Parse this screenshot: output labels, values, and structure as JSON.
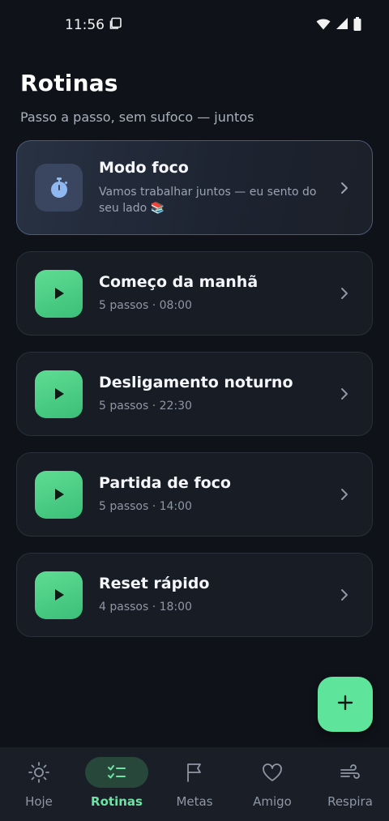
{
  "status_bar": {
    "time": "11:56"
  },
  "header": {
    "title": "Rotinas",
    "subtitle": "Passo a passo, sem sufoco — juntos"
  },
  "focus_card": {
    "title": "Modo foco",
    "subtitle": "Vamos trabalhar juntos — eu sento do seu lado 📚",
    "icon": "stopwatch-icon"
  },
  "routines": [
    {
      "title": "Começo da manhã",
      "meta": "5 passos · 08:00"
    },
    {
      "title": "Desligamento noturno",
      "meta": "5 passos · 22:30"
    },
    {
      "title": "Partida de foco",
      "meta": "5 passos · 14:00"
    },
    {
      "title": "Reset rápido",
      "meta": "4 passos · 18:00"
    }
  ],
  "fab": {
    "icon": "plus-icon"
  },
  "bottom_nav": {
    "items": [
      {
        "label": "Hoje",
        "icon": "sun-icon",
        "active": false
      },
      {
        "label": "Rotinas",
        "icon": "checklist-icon",
        "active": true
      },
      {
        "label": "Metas",
        "icon": "flag-icon",
        "active": false
      },
      {
        "label": "Amigo",
        "icon": "heart-icon",
        "active": false
      },
      {
        "label": "Respira",
        "icon": "wind-icon",
        "active": false
      }
    ]
  },
  "colors": {
    "background": "#0f1218",
    "accent_green": "#5fe49b",
    "active_nav_text": "#6ee3a4",
    "card_bg": "#181c24"
  }
}
